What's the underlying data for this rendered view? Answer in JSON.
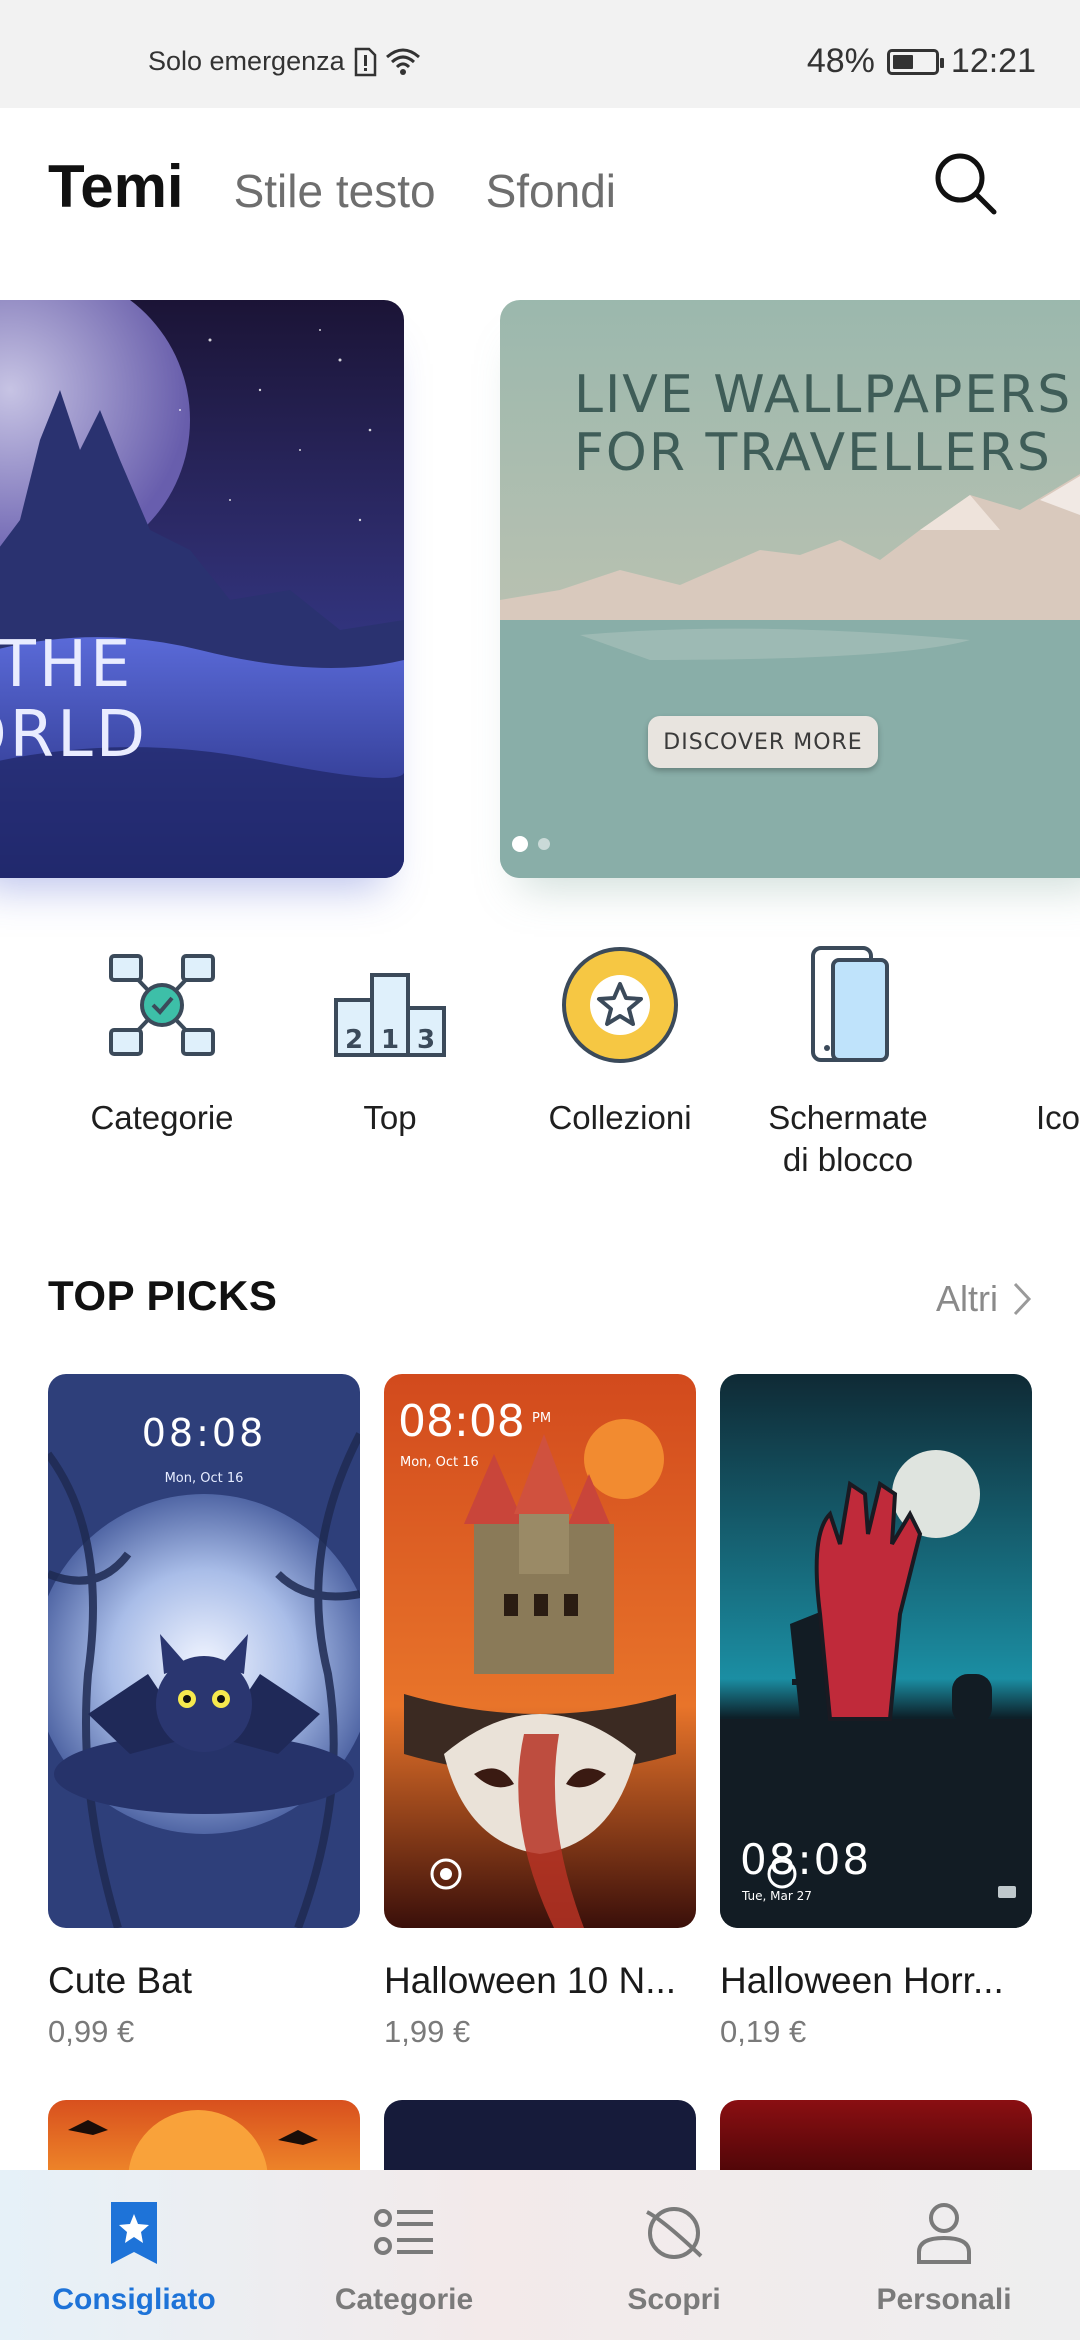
{
  "status_bar": {
    "carrier_text": "Solo emergenza",
    "battery_percent": "48%",
    "battery_level": 0.48,
    "time": "12:21"
  },
  "header": {
    "tabs": [
      {
        "label": "Temi",
        "active": true
      },
      {
        "label": "Stile testo",
        "active": false
      },
      {
        "label": "Sfondi",
        "active": false
      }
    ],
    "search_icon": "search-icon"
  },
  "banners": [
    {
      "line1": "O THE",
      "line2": "WORLD"
    },
    {
      "headline": "LIVE WALLPAPERS FOR TRAVELLERS",
      "button": "DISCOVER MORE",
      "page_count": 2,
      "active_page": 1
    }
  ],
  "quick_categories": [
    {
      "label": "Categorie",
      "icon": "categories-network-icon"
    },
    {
      "label": "Top",
      "icon": "podium-ranking-icon"
    },
    {
      "label": "Collezioni",
      "icon": "star-badge-icon"
    },
    {
      "label": "Schermate di blocco",
      "icon": "lock-screen-phones-icon"
    },
    {
      "label": "Ico",
      "icon": "lightbulb-icon"
    }
  ],
  "top_picks": {
    "title": "TOP PICKS",
    "more_label": "Altri",
    "items": [
      {
        "title": "Cute Bat",
        "price": "0,99 €",
        "clock": "08:08",
        "date": "Mon, Oct 16"
      },
      {
        "title": "Halloween 10 N...",
        "price": "1,99 €",
        "clock": "08:08",
        "ampm": "PM",
        "date": "Mon, Oct 16"
      },
      {
        "title": "Halloween Horr...",
        "price": "0,19 €",
        "clock": "08:08",
        "date": "Tue, Mar 27"
      }
    ]
  },
  "bottom_nav": [
    {
      "label": "Consigliato",
      "icon": "star-bookmark-icon",
      "active": true
    },
    {
      "label": "Categorie",
      "icon": "list-icon",
      "active": false
    },
    {
      "label": "Scopri",
      "icon": "planet-icon",
      "active": false
    },
    {
      "label": "Personali",
      "icon": "person-icon",
      "active": false
    }
  ],
  "colors": {
    "accent": "#1e73d8",
    "quick_icon_teal": "#3dbfa8",
    "quick_icon_yellow": "#f6c743",
    "quick_icon_blue": "#bfe3fb"
  }
}
